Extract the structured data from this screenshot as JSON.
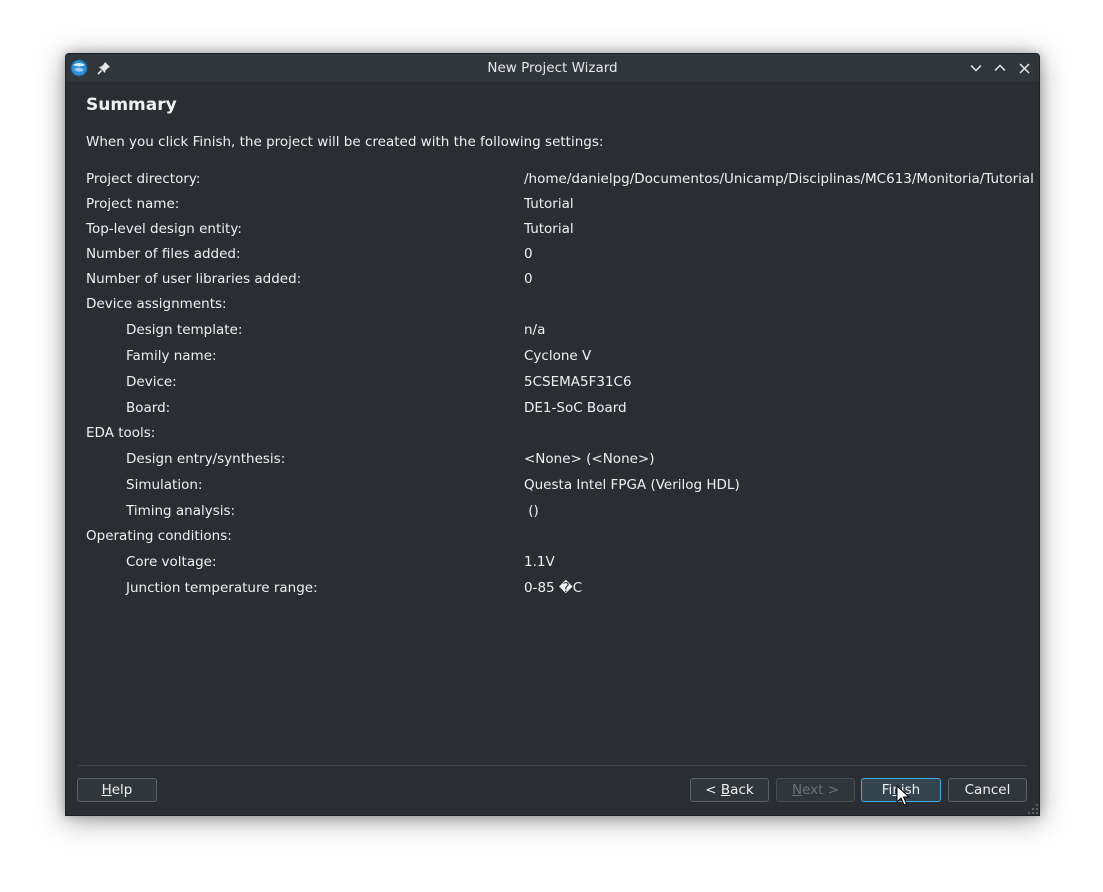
{
  "window": {
    "title": "New Project Wizard"
  },
  "page": {
    "heading": "Summary",
    "intro": "When you click Finish, the project will be created with the following settings:"
  },
  "settings": [
    {
      "label": "Project directory:",
      "value": "/home/danielpg/Documentos/Unicamp/Disciplinas/MC613/Monitoria/Tutorial",
      "indent": false
    },
    {
      "label": "Project name:",
      "value": "Tutorial",
      "indent": false
    },
    {
      "label": "Top-level design entity:",
      "value": "Tutorial",
      "indent": false
    },
    {
      "label": "Number of files added:",
      "value": "0",
      "indent": false
    },
    {
      "label": "Number of user libraries added:",
      "value": "0",
      "indent": false
    },
    {
      "label": "Device assignments:",
      "value": "",
      "indent": false
    },
    {
      "label": "Design template:",
      "value": "n/a",
      "indent": true
    },
    {
      "label": "Family name:",
      "value": "Cyclone V",
      "indent": true
    },
    {
      "label": "Device:",
      "value": "5CSEMA5F31C6",
      "indent": true
    },
    {
      "label": "Board:",
      "value": "DE1-SoC Board",
      "indent": true
    },
    {
      "label": "EDA tools:",
      "value": "",
      "indent": false
    },
    {
      "label": "Design entry/synthesis:",
      "value": "<None> (<None>)",
      "indent": true
    },
    {
      "label": "Simulation:",
      "value": "Questa Intel FPGA (Verilog HDL)",
      "indent": true
    },
    {
      "label": "Timing analysis:",
      "value": " ()",
      "indent": true
    },
    {
      "label": "Operating conditions:",
      "value": "",
      "indent": false
    },
    {
      "label": "Core voltage:",
      "value": "1.1V",
      "indent": true
    },
    {
      "label": "Junction temperature range:",
      "value": "0-85 �C",
      "indent": true
    }
  ],
  "buttons": {
    "help": {
      "mnemonic": "H",
      "rest": "elp"
    },
    "back": {
      "pre": "< ",
      "mnemonic": "B",
      "rest": "ack"
    },
    "next": {
      "mnemonic": "N",
      "rest": "ext >"
    },
    "finish": {
      "pre": "Fi",
      "mnemonic": "n",
      "rest": "ish"
    },
    "cancel": {
      "label": "Cancel"
    }
  },
  "colors": {
    "window_bg": "#2a2e32",
    "titlebar_bg": "#31363b",
    "text": "#eff0f1",
    "accent": "#3daee9",
    "disabled_text": "#6c7176"
  }
}
